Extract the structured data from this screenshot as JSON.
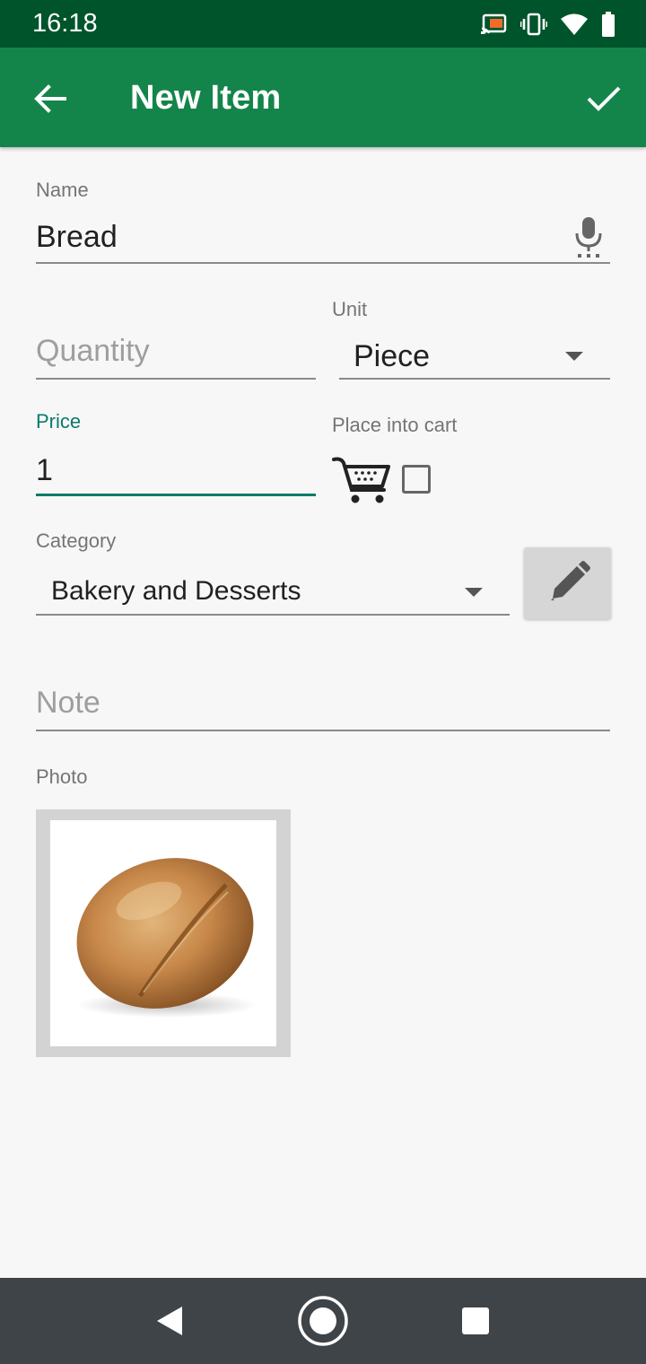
{
  "status_bar": {
    "time": "16:18",
    "icons": [
      "cast-icon",
      "vibrate-icon",
      "wifi-icon",
      "battery-icon"
    ]
  },
  "app_bar": {
    "title": "New Item",
    "back_icon": "arrow-back-icon",
    "confirm_icon": "check-icon",
    "color": "#14854a"
  },
  "form": {
    "name": {
      "label": "Name",
      "value": "Bread"
    },
    "quantity": {
      "placeholder": "Quantity",
      "value": ""
    },
    "unit": {
      "label": "Unit",
      "selected": "Piece"
    },
    "price": {
      "label": "Price",
      "value": "1"
    },
    "cart": {
      "label": "Place into cart",
      "checked": false
    },
    "category": {
      "label": "Category",
      "selected": "Bakery and Desserts"
    },
    "note": {
      "placeholder": "Note",
      "value": ""
    },
    "photo": {
      "label": "Photo",
      "subject": "bread roll"
    }
  },
  "colors": {
    "accent_focus": "#0d7a6a",
    "status_bar": "#00542b"
  },
  "nav_bar": {
    "buttons": [
      "back-triangle-icon",
      "home-circle-icon",
      "recents-square-icon"
    ]
  }
}
